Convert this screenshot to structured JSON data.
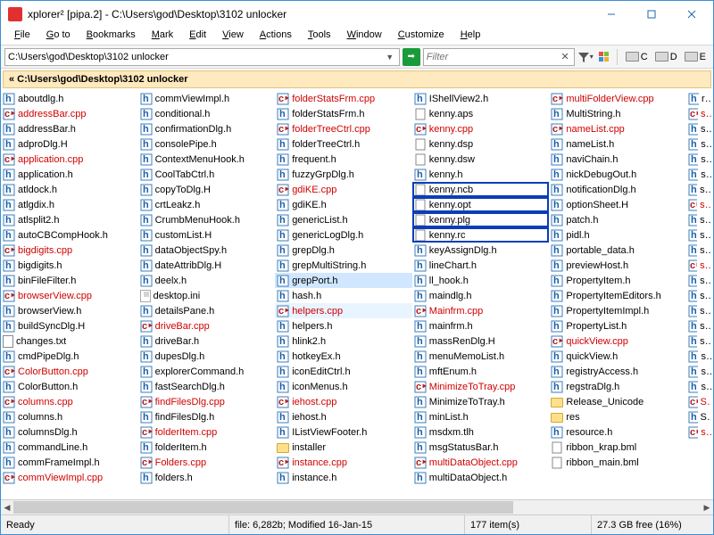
{
  "title": "xplorer² [pipa.2] - C:\\Users\\god\\Desktop\\3102 unlocker",
  "menu": [
    "File",
    "Go to",
    "Bookmarks",
    "Mark",
    "Edit",
    "View",
    "Actions",
    "Tools",
    "Window",
    "Customize",
    "Help"
  ],
  "address": {
    "path": "C:\\Users\\god\\Desktop\\3102 unlocker"
  },
  "filter_placeholder": "Filter",
  "drives": [
    "C",
    "D",
    "E"
  ],
  "breadcrumb": "« C:\\Users\\god\\Desktop\\3102 unlocker",
  "status": {
    "ready": "Ready",
    "file_info": "file: 6,282b; Modified 16-Jan-15",
    "items": "177 item(s)",
    "disk": "27.3 GB free (16%)"
  },
  "cols": [
    [
      {
        "n": "aboutdlg.h",
        "t": "h"
      },
      {
        "n": "addressBar.cpp",
        "t": "cpp"
      },
      {
        "n": "addressBar.h",
        "t": "h"
      },
      {
        "n": "adproDlg.H",
        "t": "h"
      },
      {
        "n": "application.cpp",
        "t": "cpp"
      },
      {
        "n": "application.h",
        "t": "h"
      },
      {
        "n": "atldock.h",
        "t": "h"
      },
      {
        "n": "atlgdix.h",
        "t": "h"
      },
      {
        "n": "atlsplit2.h",
        "t": "h"
      },
      {
        "n": "autoCBCompHook.h",
        "t": "h"
      },
      {
        "n": "bigdigits.cpp",
        "t": "cpp"
      },
      {
        "n": "bigdigits.h",
        "t": "h"
      },
      {
        "n": "binFileFilter.h",
        "t": "h"
      },
      {
        "n": "browserView.cpp",
        "t": "cpp"
      },
      {
        "n": "browserView.h",
        "t": "h"
      },
      {
        "n": "buildSyncDlg.H",
        "t": "h"
      },
      {
        "n": "changes.txt",
        "t": "txt"
      },
      {
        "n": "cmdPipeDlg.h",
        "t": "h"
      },
      {
        "n": "ColorButton.cpp",
        "t": "cpp"
      },
      {
        "n": "ColorButton.h",
        "t": "h"
      },
      {
        "n": "columns.cpp",
        "t": "cpp"
      },
      {
        "n": "columns.h",
        "t": "h"
      },
      {
        "n": "columnsDlg.h",
        "t": "h"
      },
      {
        "n": "commandLine.h",
        "t": "h"
      },
      {
        "n": "commFrameImpl.h",
        "t": "h"
      },
      {
        "n": "commViewImpl.cpp",
        "t": "cpp"
      }
    ],
    [
      {
        "n": "commViewImpl.h",
        "t": "h"
      },
      {
        "n": "conditional.h",
        "t": "h"
      },
      {
        "n": "confirmationDlg.h",
        "t": "h"
      },
      {
        "n": "consolePipe.h",
        "t": "h"
      },
      {
        "n": "ContextMenuHook.h",
        "t": "h"
      },
      {
        "n": "CoolTabCtrl.h",
        "t": "h"
      },
      {
        "n": "copyToDlg.H",
        "t": "h"
      },
      {
        "n": "crtLeakz.h",
        "t": "h"
      },
      {
        "n": "CrumbMenuHook.h",
        "t": "h"
      },
      {
        "n": "customList.H",
        "t": "h"
      },
      {
        "n": "dataObjectSpy.h",
        "t": "h"
      },
      {
        "n": "dateAttribDlg.H",
        "t": "h"
      },
      {
        "n": "deelx.h",
        "t": "h"
      },
      {
        "n": "desktop.ini",
        "t": "ini"
      },
      {
        "n": "detailsPane.h",
        "t": "h"
      },
      {
        "n": "driveBar.cpp",
        "t": "cpp"
      },
      {
        "n": "driveBar.h",
        "t": "h"
      },
      {
        "n": "dupesDlg.h",
        "t": "h"
      },
      {
        "n": "explorerCommand.h",
        "t": "h"
      },
      {
        "n": "fastSearchDlg.h",
        "t": "h"
      },
      {
        "n": "findFilesDlg.cpp",
        "t": "cpp"
      },
      {
        "n": "findFilesDlg.h",
        "t": "h"
      },
      {
        "n": "folderItem.cpp",
        "t": "cpp"
      },
      {
        "n": "folderItem.h",
        "t": "h"
      },
      {
        "n": "Folders.cpp",
        "t": "cpp"
      },
      {
        "n": "folders.h",
        "t": "h"
      }
    ],
    [
      {
        "n": "folderStatsFrm.cpp",
        "t": "cpp"
      },
      {
        "n": "folderStatsFrm.h",
        "t": "h"
      },
      {
        "n": "folderTreeCtrl.cpp",
        "t": "cpp"
      },
      {
        "n": "folderTreeCtrl.h",
        "t": "h"
      },
      {
        "n": "frequent.h",
        "t": "h"
      },
      {
        "n": "fuzzyGrpDlg.h",
        "t": "h"
      },
      {
        "n": "gdiKE.cpp",
        "t": "cpp"
      },
      {
        "n": "gdiKE.h",
        "t": "h"
      },
      {
        "n": "genericList.h",
        "t": "h"
      },
      {
        "n": "genericLogDlg.h",
        "t": "h"
      },
      {
        "n": "grepDlg.h",
        "t": "h"
      },
      {
        "n": "grepMultiString.h",
        "t": "h"
      },
      {
        "n": "grepPort.h",
        "t": "h",
        "sel": true
      },
      {
        "n": "hash.h",
        "t": "h"
      },
      {
        "n": "helpers.cpp",
        "t": "cpp",
        "hl": true
      },
      {
        "n": "helpers.h",
        "t": "h"
      },
      {
        "n": "hlink2.h",
        "t": "h"
      },
      {
        "n": "hotkeyEx.h",
        "t": "h"
      },
      {
        "n": "iconEditCtrl.h",
        "t": "h"
      },
      {
        "n": "iconMenus.h",
        "t": "h"
      },
      {
        "n": "iehost.cpp",
        "t": "cpp"
      },
      {
        "n": "iehost.h",
        "t": "h"
      },
      {
        "n": "IListViewFooter.h",
        "t": "h"
      },
      {
        "n": "installer",
        "t": "folder"
      },
      {
        "n": "instance.cpp",
        "t": "cpp"
      },
      {
        "n": "instance.h",
        "t": "h"
      }
    ],
    [
      {
        "n": "IShellView2.h",
        "t": "h"
      },
      {
        "n": "kenny.aps",
        "t": "misc"
      },
      {
        "n": "kenny.cpp",
        "t": "cpp"
      },
      {
        "n": "kenny.dsp",
        "t": "misc"
      },
      {
        "n": "kenny.dsw",
        "t": "misc"
      },
      {
        "n": "kenny.h",
        "t": "h"
      },
      {
        "n": "kenny.ncb",
        "t": "misc",
        "box": true
      },
      {
        "n": "kenny.opt",
        "t": "misc",
        "box": true
      },
      {
        "n": "kenny.plg",
        "t": "misc",
        "box": true
      },
      {
        "n": "kenny.rc",
        "t": "misc",
        "box": true
      },
      {
        "n": "keyAssignDlg.h",
        "t": "h"
      },
      {
        "n": "lineChart.h",
        "t": "h"
      },
      {
        "n": "ll_hook.h",
        "t": "h"
      },
      {
        "n": "maindlg.h",
        "t": "h"
      },
      {
        "n": "Mainfrm.cpp",
        "t": "cpp"
      },
      {
        "n": "mainfrm.h",
        "t": "h"
      },
      {
        "n": "massRenDlg.H",
        "t": "h"
      },
      {
        "n": "menuMemoList.h",
        "t": "h"
      },
      {
        "n": "mftEnum.h",
        "t": "h"
      },
      {
        "n": "MinimizeToTray.cpp",
        "t": "cpp"
      },
      {
        "n": "MinimizeToTray.h",
        "t": "h"
      },
      {
        "n": "minList.h",
        "t": "h"
      },
      {
        "n": "msdxm.tlh",
        "t": "h"
      },
      {
        "n": "msgStatusBar.h",
        "t": "h"
      },
      {
        "n": "multiDataObject.cpp",
        "t": "cpp"
      },
      {
        "n": "multiDataObject.h",
        "t": "h"
      }
    ],
    [
      {
        "n": "multiFolderView.cpp",
        "t": "cpp"
      },
      {
        "n": "MultiString.h",
        "t": "h"
      },
      {
        "n": "nameList.cpp",
        "t": "cpp"
      },
      {
        "n": "nameList.h",
        "t": "h"
      },
      {
        "n": "naviChain.h",
        "t": "h"
      },
      {
        "n": "nickDebugOut.h",
        "t": "h"
      },
      {
        "n": "notificationDlg.h",
        "t": "h"
      },
      {
        "n": "optionSheet.H",
        "t": "h"
      },
      {
        "n": "patch.h",
        "t": "h"
      },
      {
        "n": "pidl.h",
        "t": "h"
      },
      {
        "n": "portable_data.h",
        "t": "h"
      },
      {
        "n": "previewHost.h",
        "t": "h"
      },
      {
        "n": "PropertyItem.h",
        "t": "h"
      },
      {
        "n": "PropertyItemEditors.h",
        "t": "h"
      },
      {
        "n": "PropertyItemImpl.h",
        "t": "h"
      },
      {
        "n": "PropertyList.h",
        "t": "h"
      },
      {
        "n": "quickView.cpp",
        "t": "cpp"
      },
      {
        "n": "quickView.h",
        "t": "h"
      },
      {
        "n": "registryAccess.h",
        "t": "h"
      },
      {
        "n": "regstraDlg.h",
        "t": "h"
      },
      {
        "n": "Release_Unicode",
        "t": "folder"
      },
      {
        "n": "res",
        "t": "folder"
      },
      {
        "n": "resource.h",
        "t": "h"
      },
      {
        "n": "ribbon_krap.bml",
        "t": "misc"
      },
      {
        "n": "ribbon_main.bml",
        "t": "misc"
      }
    ],
    [
      {
        "n": "rot",
        "t": "h"
      },
      {
        "n": "sar",
        "t": "cpp"
      },
      {
        "n": "sar",
        "t": "h"
      },
      {
        "n": "scr",
        "t": "h"
      },
      {
        "n": "scr",
        "t": "h"
      },
      {
        "n": "scr",
        "t": "h"
      },
      {
        "n": "sea",
        "t": "h"
      },
      {
        "n": "she",
        "t": "cpp"
      },
      {
        "n": "she",
        "t": "h"
      },
      {
        "n": "she",
        "t": "h"
      },
      {
        "n": "she",
        "t": "h"
      },
      {
        "n": "she",
        "t": "cpp"
      },
      {
        "n": "she",
        "t": "h"
      },
      {
        "n": "she",
        "t": "h"
      },
      {
        "n": "she",
        "t": "h"
      },
      {
        "n": "she",
        "t": "h"
      },
      {
        "n": "she",
        "t": "h"
      },
      {
        "n": "sid",
        "t": "h"
      },
      {
        "n": "sin",
        "t": "h"
      },
      {
        "n": "spl",
        "t": "h"
      },
      {
        "n": "Sta",
        "t": "cpp"
      },
      {
        "n": "Sta",
        "t": "h"
      },
      {
        "n": "std",
        "t": "cpp"
      }
    ]
  ]
}
